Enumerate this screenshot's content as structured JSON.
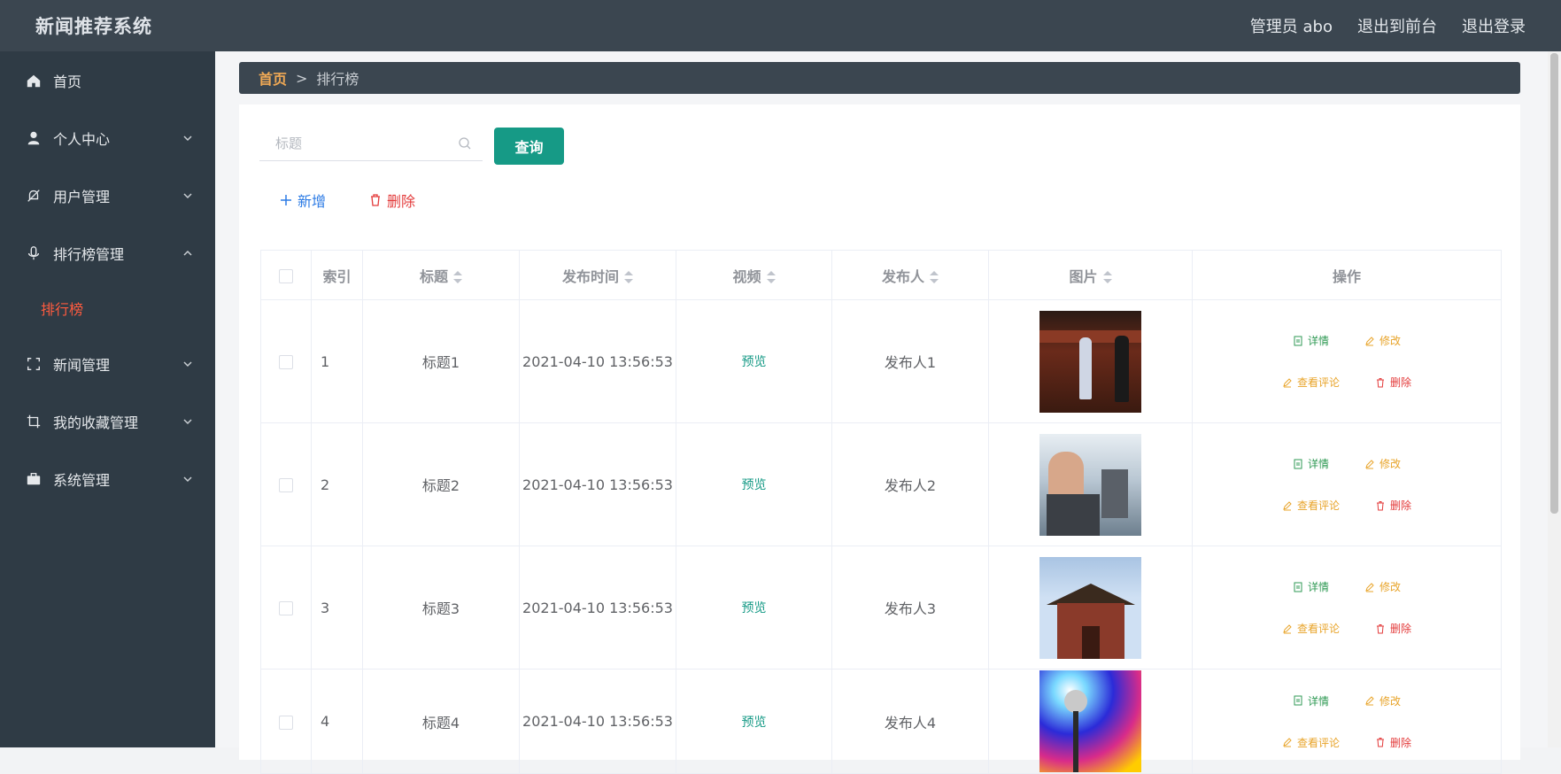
{
  "app": {
    "title": "新闻推荐系统"
  },
  "header": {
    "user": "管理员 abo",
    "to_front": "退出到前台",
    "logout": "退出登录"
  },
  "sidebar": {
    "items": [
      {
        "label": "首页",
        "icon": "home-icon"
      },
      {
        "label": "个人中心",
        "icon": "user-icon"
      },
      {
        "label": "用户管理",
        "icon": "bell-off-icon"
      },
      {
        "label": "排行榜管理",
        "icon": "microphone-icon"
      },
      {
        "label": "新闻管理",
        "icon": "frame-icon"
      },
      {
        "label": "我的收藏管理",
        "icon": "crop-icon"
      },
      {
        "label": "系统管理",
        "icon": "briefcase-icon"
      }
    ],
    "subitem": "排行榜"
  },
  "breadcrumb": {
    "home": "首页",
    "sep": ">",
    "current": "排行榜"
  },
  "search": {
    "placeholder": "标题",
    "button": "查询"
  },
  "actions": {
    "add": "新增",
    "delete": "删除"
  },
  "table": {
    "headers": {
      "index": "索引",
      "title": "标题",
      "time": "发布时间",
      "video": "视频",
      "publisher": "发布人",
      "image": "图片",
      "ops": "操作"
    },
    "rows": [
      {
        "index": "1",
        "title": "标题1",
        "time": "2021-04-10 13:56:53",
        "video": "预览",
        "publisher": "发布人1"
      },
      {
        "index": "2",
        "title": "标题2",
        "time": "2021-04-10 13:56:53",
        "video": "预览",
        "publisher": "发布人2"
      },
      {
        "index": "3",
        "title": "标题3",
        "time": "2021-04-10 13:56:53",
        "video": "预览",
        "publisher": "发布人3"
      },
      {
        "index": "4",
        "title": "标题4",
        "time": "2021-04-10 13:56:53",
        "video": "预览",
        "publisher": "发布人4"
      }
    ],
    "ops": {
      "detail": "详情",
      "edit": "修改",
      "comments": "查看评论",
      "delete": "删除"
    }
  },
  "colors": {
    "topbar": "#3b4650",
    "sidebar": "#2f3b45",
    "accent": "#169a86",
    "active_menu": "#ff5b3f"
  }
}
